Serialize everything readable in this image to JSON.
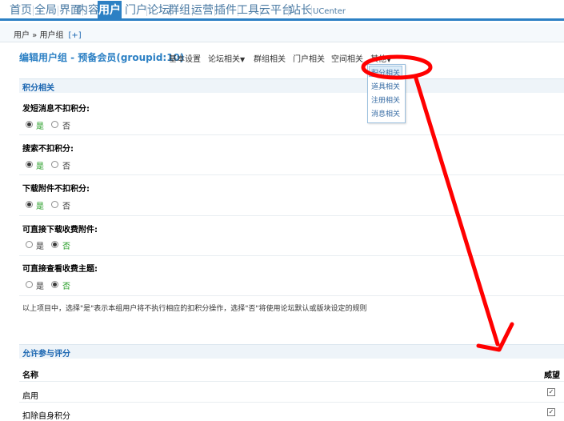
{
  "topnav": {
    "items": [
      "首页",
      "全局",
      "界面",
      "内容",
      "用户",
      "门户",
      "论坛",
      "群组",
      "运营",
      "插件",
      "工具",
      "云平台",
      "站长",
      "UCenter"
    ]
  },
  "breadcrumb": {
    "path": "用户 » 用户组",
    "plus": "[+]"
  },
  "page": {
    "title": "编辑用户组 - 预备会员(groupid:10)"
  },
  "tabs": [
    "基本设置",
    "论坛相关",
    "群组相关",
    "门户相关",
    "空间相关",
    "其他"
  ],
  "dropdown": {
    "items": [
      "积分相关",
      "道具相关",
      "注册相关",
      "消息相关"
    ]
  },
  "section1": {
    "title": "积分相关"
  },
  "questions": [
    {
      "label": "发短消息不扣积分:",
      "yes": "是",
      "no": "否",
      "selected": "yes"
    },
    {
      "label": "搜索不扣积分:",
      "yes": "是",
      "no": "否",
      "selected": "yes"
    },
    {
      "label": "下载附件不扣积分:",
      "yes": "是",
      "no": "否",
      "selected": "yes"
    },
    {
      "label": "可直接下载收费附件:",
      "yes": "是",
      "no": "否",
      "selected": "no"
    },
    {
      "label": "可直接查看收费主题:",
      "yes": "是",
      "no": "否",
      "selected": "no"
    }
  ],
  "note": "以上项目中，选择\"是\"表示本组用户将不执行相应的扣积分操作，选择\"否\"将使用论坛默认或版块设定的规则",
  "section2": {
    "title": "允许参与评分"
  },
  "table": {
    "headers": [
      "名称",
      "威望"
    ],
    "rows": [
      {
        "label": "启用",
        "checked": true
      },
      {
        "label": "扣除自身积分",
        "checked": true
      }
    ]
  },
  "colors": {
    "accent": "#2c80c4",
    "link": "#1b66b1",
    "annotation": "#ff0000",
    "selected_green": "#1f9a1f"
  }
}
